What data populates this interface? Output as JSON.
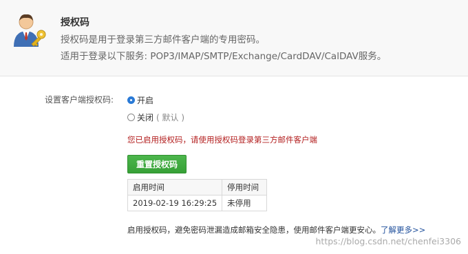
{
  "header": {
    "title": "授权码",
    "line1": "授权码是用于登录第三方邮件客户端的专用密码。",
    "line2": "适用于登录以下服务: POP3/IMAP/SMTP/Exchange/CardDAV/CalDAV服务。",
    "avatar_icon": "user-key-icon"
  },
  "settings": {
    "label": "设置客户端授权码:",
    "option_on": "开启",
    "option_off": "关闭",
    "option_off_default": "( 默认 )",
    "selected": "on"
  },
  "notice": "您已启用授权码，请使用授权码登录第三方邮件客户端",
  "reset_button": "重置授权码",
  "table": {
    "headers": [
      "启用时间",
      "停用时间"
    ],
    "rows": [
      [
        "2019-02-19 16:29:25",
        "未停用"
      ]
    ]
  },
  "footer": {
    "text": "启用授权码，避免密码泄漏造成邮箱安全隐患，使用邮件客户端更安心。",
    "link": "了解更多>>"
  },
  "watermark": "https://blog.csdn.net/chenfei3306",
  "colors": {
    "accent_green": "#3aa63a",
    "notice_red": "#b31f1f",
    "link_blue": "#1f4f9b",
    "radio_blue": "#2a7ad6"
  }
}
